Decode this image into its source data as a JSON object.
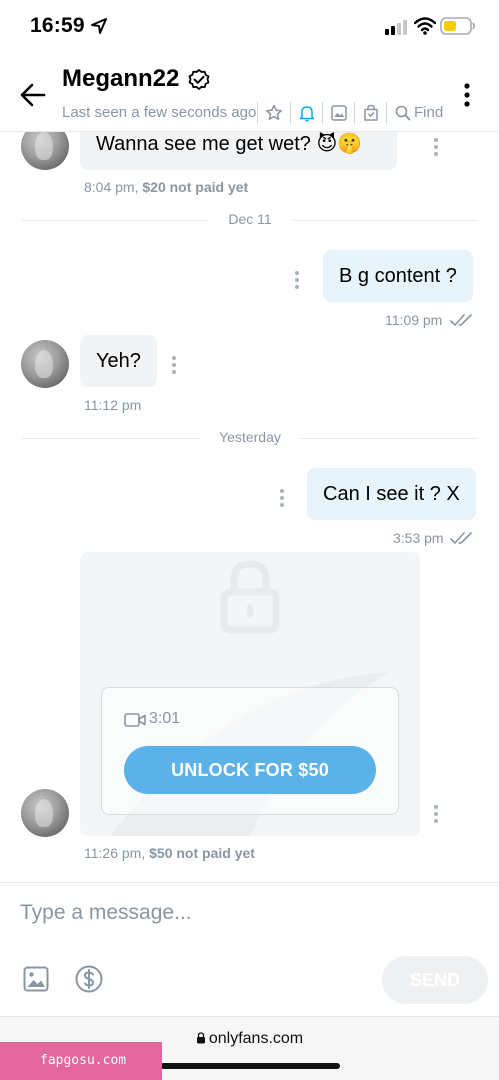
{
  "status_bar": {
    "time": "16:59"
  },
  "header": {
    "name": "Megann22",
    "last_seen": "Last seen a few seconds ago",
    "find_label": "Find"
  },
  "messages": [
    {
      "side": "in",
      "text": "Wanna see me get wet? 😈🤫",
      "time": "8:04 pm,",
      "price_note": "$20 not paid yet"
    },
    {
      "divider": "Dec 11"
    },
    {
      "side": "out",
      "text": "B g content ?",
      "time": "11:09 pm"
    },
    {
      "side": "in",
      "text": "Yeh?",
      "time": "11:12 pm"
    },
    {
      "divider": "Yesterday"
    },
    {
      "side": "out",
      "text": "Can I see it ? X",
      "time": "3:53 pm"
    },
    {
      "side": "in",
      "type": "locked-video",
      "duration": "3:01",
      "unlock_label": "UNLOCK FOR $50",
      "time": "11:26 pm,",
      "price_note": "$50 not paid yet"
    }
  ],
  "composer": {
    "placeholder": "Type a message...",
    "send_label": "SEND"
  },
  "browser": {
    "url": "onlyfans.com"
  },
  "watermark": "fapgosu.com",
  "colors": {
    "accent": "#00aff0",
    "unlock_button": "#5bb2e8",
    "outgoing_bubble": "#e7f4fb",
    "incoming_bubble": "#f2f3f5",
    "watermark_bg": "#e2679c"
  }
}
